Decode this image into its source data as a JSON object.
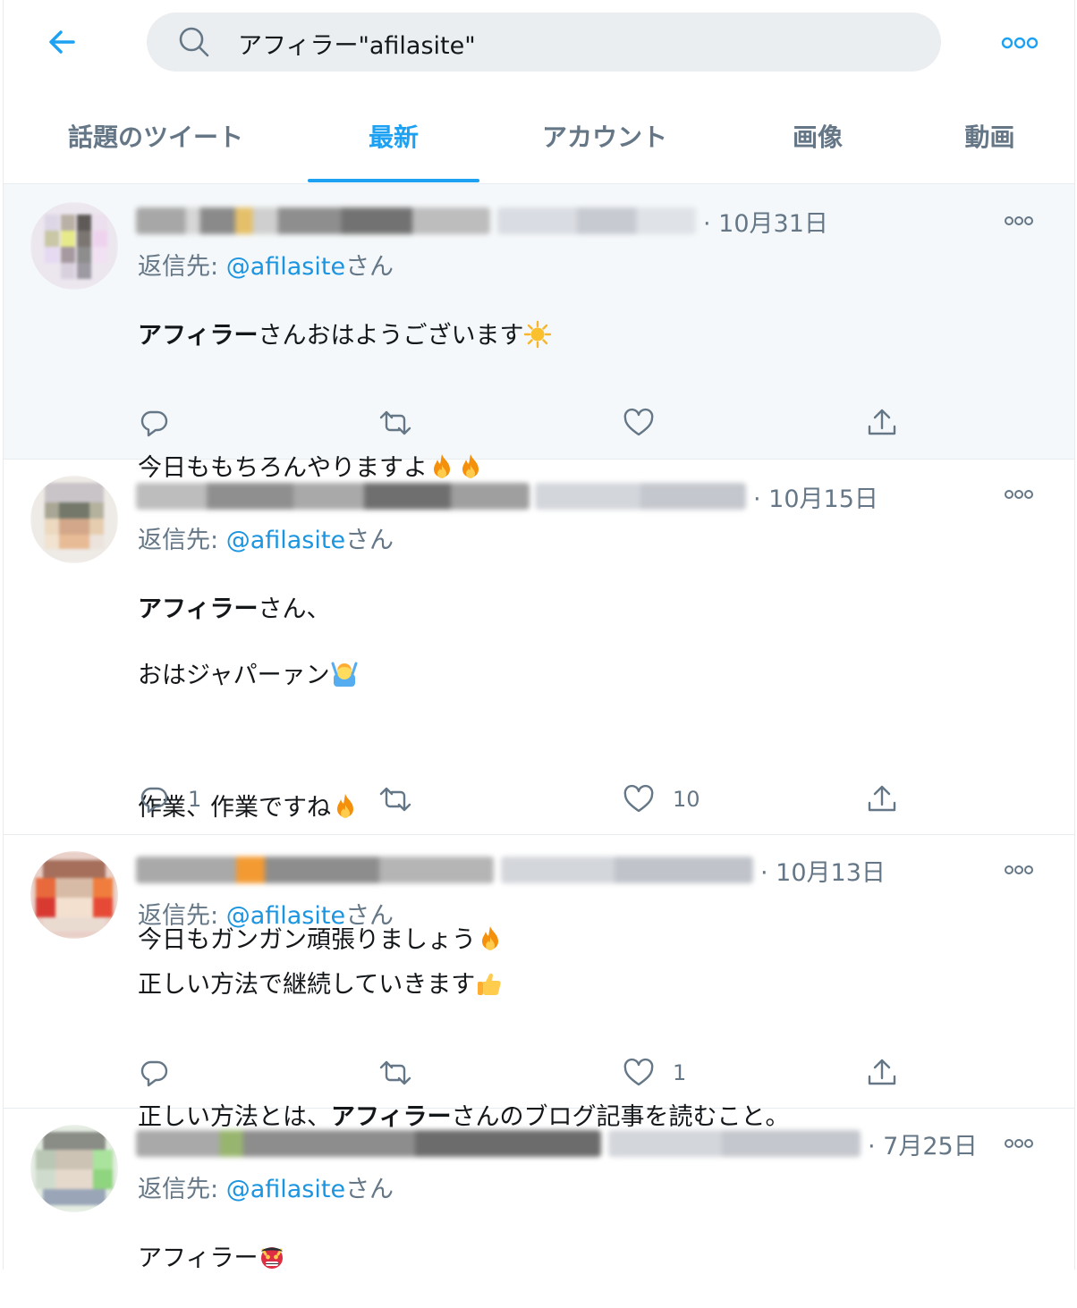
{
  "search": {
    "query": "アフィラー\"afilasite\""
  },
  "tabs": [
    {
      "label": "話題のツイート",
      "active": false
    },
    {
      "label": "最新",
      "active": true
    },
    {
      "label": "アカウント",
      "active": false
    },
    {
      "label": "画像",
      "active": false
    },
    {
      "label": "動画",
      "active": false
    }
  ],
  "icons": {
    "back": "arrow-left-icon",
    "search": "search-icon",
    "more": "more-horizontal-icon",
    "reply": "reply-icon",
    "retweet": "retweet-icon",
    "like": "heart-icon",
    "share": "share-icon"
  },
  "colors": {
    "accent": "#1da1f2",
    "secondary": "#657786",
    "link": "#1b95e0",
    "hover_bg": "#f5f8fa"
  },
  "reply_label": "返信先: ",
  "reply_handle": "@afilasite",
  "reply_suffix": "さん",
  "tweets": [
    {
      "date": "· 10月31日",
      "lines": [
        {
          "bold": "アフィラー",
          "text": "さんおはようございます",
          "emoji": "sun"
        },
        {
          "bold": "",
          "text": "",
          "emoji": ""
        },
        {
          "bold": "",
          "text": "今日ももちろんやりますよ",
          "emoji": "fire-fire"
        }
      ],
      "reply_count": "",
      "like_count": ""
    },
    {
      "date": "· 10月15日",
      "lines": [
        {
          "bold": "アフィラー",
          "text": "さん、",
          "emoji": ""
        },
        {
          "bold": "",
          "text": "おはジャパーァン",
          "emoji": "person-gesturing"
        },
        {
          "bold": "",
          "text": "",
          "emoji": ""
        },
        {
          "bold": "",
          "text": "作業、作業ですね",
          "emoji": "fire"
        },
        {
          "bold": "",
          "text": "",
          "emoji": ""
        },
        {
          "bold": "",
          "text": "今日もガンガン頑張りましょう",
          "emoji": "fire"
        }
      ],
      "reply_count": "1",
      "like_count": "10"
    },
    {
      "date": "· 10月13日",
      "lines": [
        {
          "bold": "",
          "text": "正しい方法で継続していきます",
          "emoji": "thumbs-up"
        },
        {
          "bold": "",
          "text": "",
          "emoji": ""
        },
        {
          "pre": "正しい方法とは、",
          "bold": "アフィラー",
          "text": "さんのブログ記事を読むこと。",
          "emoji": ""
        }
      ],
      "reply_count": "",
      "like_count": "1"
    },
    {
      "date": "· 7月25日",
      "lines": [
        {
          "bold": "",
          "text": "アフィラー",
          "emoji": "ogre"
        }
      ],
      "reply_count": "",
      "like_count": ""
    }
  ]
}
